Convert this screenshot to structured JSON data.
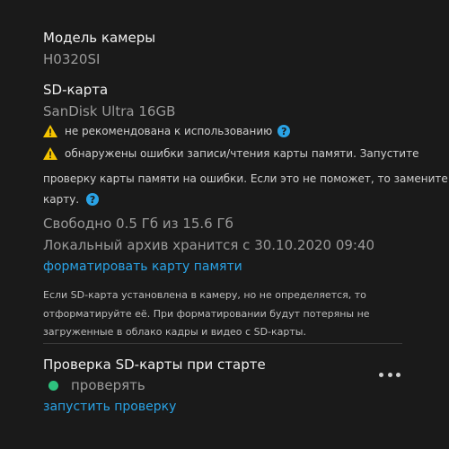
{
  "camera": {
    "model_label": "Модель камеры",
    "model_value": "H0320SI"
  },
  "sd": {
    "label": "SD-карта",
    "card_name": "SanDisk Ultra 16GB",
    "warning_1": "не рекомендована к использованию",
    "warning_2_line_1": "обнаружены ошибки записи/чтения карты памяти. Запустите",
    "warning_2_line_2": "проверку карты памяти на ошибки. Если это не поможет, то замените",
    "warning_2_line_3": "карту.",
    "free_space": "Свободно 0.5 Гб из 15.6 Гб",
    "archive": "Локальный архив хранится с 30.10.2020 09:40",
    "format_link": "форматировать карту памяти",
    "note_line_1": "Если SD-карта установлена в камеру, но не определяется, то",
    "note_line_2": "отформатируйте её. При форматировании будут потеряны не",
    "note_line_3": "загруженные в облако кадры и видео с SD-карты."
  },
  "startup_check": {
    "label": "Проверка SD-карты при старте",
    "status": "проверять",
    "run_link": "запустить проверку"
  },
  "icons": {
    "warning": "warning-icon",
    "help": "help-icon",
    "more": "more-icon"
  },
  "colors": {
    "background": "#1a1a1a",
    "accent": "#2aa3e6",
    "warning": "#f5c400",
    "status_ok": "#2ec27e"
  }
}
